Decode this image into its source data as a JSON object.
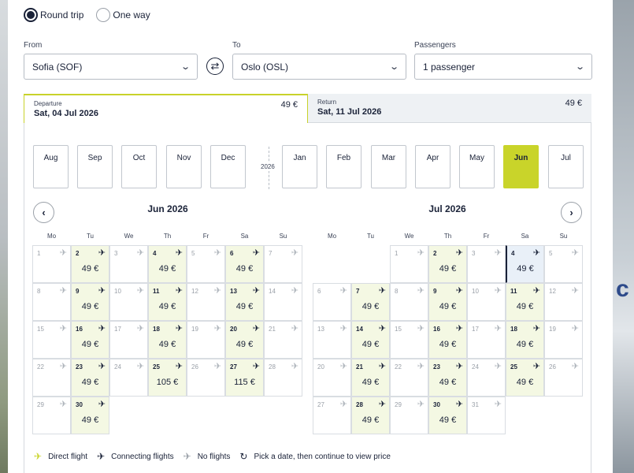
{
  "trip_type": {
    "round_trip": "Round trip",
    "one_way": "One way"
  },
  "form": {
    "from_label": "From",
    "from_value": "Sofia (SOF)",
    "to_label": "To",
    "to_value": "Oslo (OSL)",
    "passengers_label": "Passengers",
    "passengers_value": "1 passenger"
  },
  "tabs": {
    "departure": {
      "label": "Departure",
      "date": "Sat, 04 Jul 2026",
      "price": "49 €"
    },
    "return": {
      "label": "Return",
      "date": "Sat, 11 Jul 2026",
      "price": "49 €"
    }
  },
  "months": [
    "Aug",
    "Sep",
    "Oct",
    "Nov",
    "Dec",
    "Jan",
    "Feb",
    "Mar",
    "Apr",
    "May",
    "Jun",
    "Jul"
  ],
  "selected_month": "Jun",
  "year_divider": "2026",
  "weekdays": [
    "Mo",
    "Tu",
    "We",
    "Th",
    "Fr",
    "Sa",
    "Su"
  ],
  "calendars": [
    {
      "title": "Jun 2026",
      "days": [
        {
          "d": "1",
          "price": ""
        },
        {
          "d": "2",
          "price": "49 €"
        },
        {
          "d": "3",
          "price": ""
        },
        {
          "d": "4",
          "price": "49 €"
        },
        {
          "d": "5",
          "price": ""
        },
        {
          "d": "6",
          "price": "49 €"
        },
        {
          "d": "7",
          "price": ""
        },
        {
          "d": "8",
          "price": ""
        },
        {
          "d": "9",
          "price": "49 €"
        },
        {
          "d": "10",
          "price": ""
        },
        {
          "d": "11",
          "price": "49 €"
        },
        {
          "d": "12",
          "price": ""
        },
        {
          "d": "13",
          "price": "49 €"
        },
        {
          "d": "14",
          "price": ""
        },
        {
          "d": "15",
          "price": ""
        },
        {
          "d": "16",
          "price": "49 €"
        },
        {
          "d": "17",
          "price": ""
        },
        {
          "d": "18",
          "price": "49 €"
        },
        {
          "d": "19",
          "price": ""
        },
        {
          "d": "20",
          "price": "49 €"
        },
        {
          "d": "21",
          "price": ""
        },
        {
          "d": "22",
          "price": ""
        },
        {
          "d": "23",
          "price": "49 €"
        },
        {
          "d": "24",
          "price": ""
        },
        {
          "d": "25",
          "price": "105 €"
        },
        {
          "d": "26",
          "price": ""
        },
        {
          "d": "27",
          "price": "115 €"
        },
        {
          "d": "28",
          "price": ""
        },
        {
          "d": "29",
          "price": ""
        },
        {
          "d": "30",
          "price": "49 €"
        }
      ]
    },
    {
      "title": "Jul 2026",
      "days": [
        {
          "d": "1",
          "price": ""
        },
        {
          "d": "2",
          "price": "49 €"
        },
        {
          "d": "3",
          "price": ""
        },
        {
          "d": "4",
          "price": "49 €",
          "selected": true
        },
        {
          "d": "5",
          "price": ""
        },
        {
          "d": "6",
          "price": ""
        },
        {
          "d": "7",
          "price": "49 €"
        },
        {
          "d": "8",
          "price": ""
        },
        {
          "d": "9",
          "price": "49 €"
        },
        {
          "d": "10",
          "price": ""
        },
        {
          "d": "11",
          "price": "49 €"
        },
        {
          "d": "12",
          "price": ""
        },
        {
          "d": "13",
          "price": ""
        },
        {
          "d": "14",
          "price": "49 €"
        },
        {
          "d": "15",
          "price": ""
        },
        {
          "d": "16",
          "price": "49 €"
        },
        {
          "d": "17",
          "price": ""
        },
        {
          "d": "18",
          "price": "49 €"
        },
        {
          "d": "19",
          "price": ""
        },
        {
          "d": "20",
          "price": ""
        },
        {
          "d": "21",
          "price": "49 €"
        },
        {
          "d": "22",
          "price": ""
        },
        {
          "d": "23",
          "price": "49 €"
        },
        {
          "d": "24",
          "price": ""
        },
        {
          "d": "25",
          "price": "49 €"
        },
        {
          "d": "26",
          "price": ""
        },
        {
          "d": "27",
          "price": ""
        },
        {
          "d": "28",
          "price": "49 €"
        },
        {
          "d": "29",
          "price": ""
        },
        {
          "d": "30",
          "price": "49 €"
        },
        {
          "d": "31",
          "price": ""
        }
      ]
    }
  ],
  "legend": {
    "direct": "Direct flight",
    "connecting": "Connecting flights",
    "none": "No flights",
    "hint": "Pick a date, then continue to view price"
  },
  "colors": {
    "accent": "#c9d42a",
    "available_bg": "#f4f8e3",
    "navy": "#1a2238"
  }
}
